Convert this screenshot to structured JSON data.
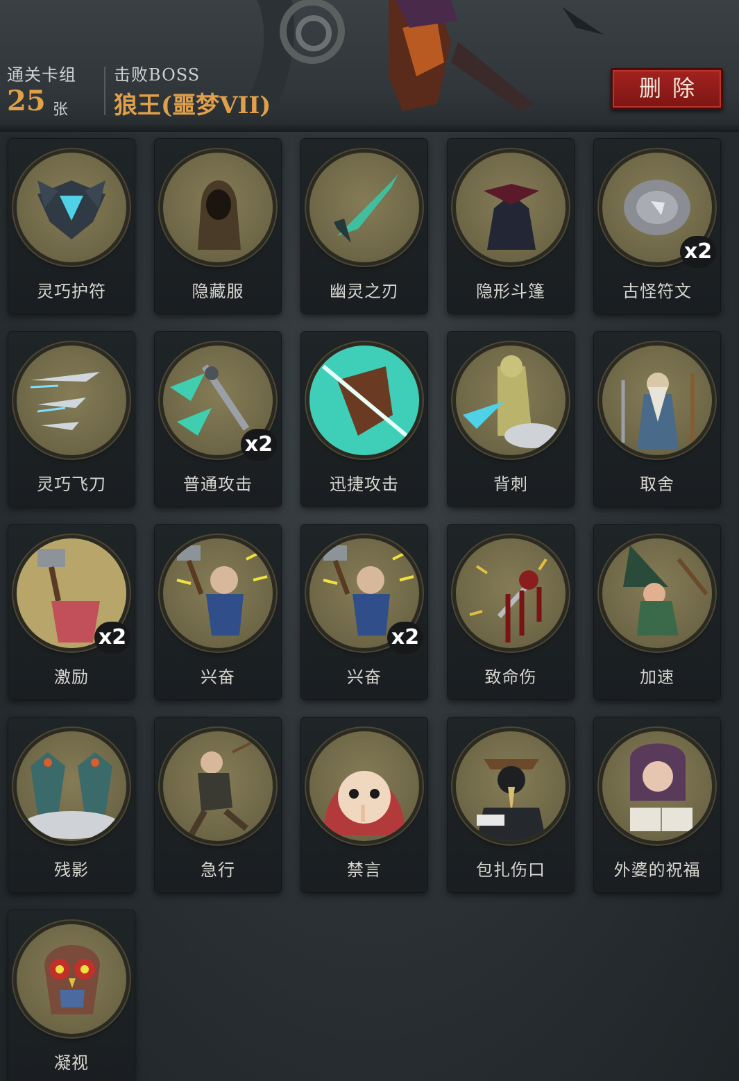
{
  "header": {
    "cleared_label": "通关卡组",
    "cleared_count": "25",
    "cleared_unit": "张",
    "boss_label": "击败BOSS",
    "boss_name": "狼王(噩梦VII)",
    "delete_button": "删除"
  },
  "colors": {
    "accent": "#e0a04a",
    "delete": "#9a1f1c",
    "medallion": "#7b7350",
    "card": "#1d2124"
  },
  "cards": [
    {
      "name": "灵巧护符",
      "icon": "amulet-icon",
      "badge": ""
    },
    {
      "name": "隐藏服",
      "icon": "hood-cloak-icon",
      "badge": ""
    },
    {
      "name": "幽灵之刃",
      "icon": "ghost-blade-icon",
      "badge": ""
    },
    {
      "name": "隐形斗篷",
      "icon": "cloak-icon",
      "badge": ""
    },
    {
      "name": "古怪符文",
      "icon": "rune-stone-icon",
      "badge": "x2"
    },
    {
      "name": "灵巧飞刀",
      "icon": "throwing-knives-icon",
      "badge": ""
    },
    {
      "name": "普通攻击",
      "icon": "basic-attack-icon",
      "badge": "x2"
    },
    {
      "name": "迅捷攻击",
      "icon": "swift-attack-icon",
      "badge": ""
    },
    {
      "name": "背刺",
      "icon": "backstab-icon",
      "badge": ""
    },
    {
      "name": "取舍",
      "icon": "sage-icon",
      "badge": ""
    },
    {
      "name": "激励",
      "icon": "hammer-brute-icon",
      "badge": "x2"
    },
    {
      "name": "兴奋",
      "icon": "hammer-dwarf-icon",
      "badge": ""
    },
    {
      "name": "兴奋",
      "icon": "hammer-dwarf-icon",
      "badge": "x2"
    },
    {
      "name": "致命伤",
      "icon": "bleeding-dagger-icon",
      "badge": ""
    },
    {
      "name": "加速",
      "icon": "witch-broom-icon",
      "badge": ""
    },
    {
      "name": "残影",
      "icon": "afterimage-icon",
      "badge": ""
    },
    {
      "name": "急行",
      "icon": "running-warrior-icon",
      "badge": ""
    },
    {
      "name": "禁言",
      "icon": "hush-girl-icon",
      "badge": ""
    },
    {
      "name": "包扎伤口",
      "icon": "plague-doctor-icon",
      "badge": ""
    },
    {
      "name": "外婆的祝福",
      "icon": "grandma-icon",
      "badge": ""
    },
    {
      "name": "凝视",
      "icon": "owl-icon",
      "badge": ""
    }
  ]
}
